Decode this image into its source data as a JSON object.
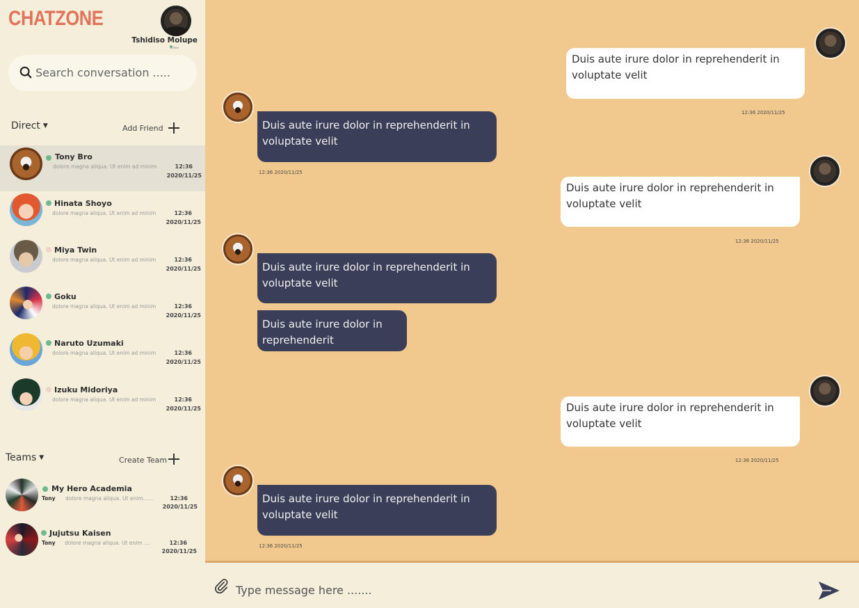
{
  "app": {
    "brand": "CHATZONE"
  },
  "user": {
    "name": "Tshidiso Molupe",
    "status": "online"
  },
  "search": {
    "placeholder": "Search conversation ....."
  },
  "direct": {
    "title": "Direct",
    "add_label": "Add Friend",
    "contacts": [
      {
        "name": "Tony Bro",
        "online": true,
        "preview": "dolore magna aliqua. Ut enim ad minim",
        "time": "12:36",
        "date": "2020/11/25"
      },
      {
        "name": "Hinata Shoyo",
        "online": true,
        "preview": "dolore magna aliqua. Ut enim ad minim",
        "time": "12:36",
        "date": "2020/11/25"
      },
      {
        "name": "Miya Twin",
        "online": false,
        "preview": "dolore magna aliqua. Ut enim ad minim",
        "time": "12:36",
        "date": "2020/11/25"
      },
      {
        "name": "Goku",
        "online": true,
        "preview": "dolore magna aliqua. Ut enim ad minim",
        "time": "12:36",
        "date": "2020/11/25"
      },
      {
        "name": "Naruto Uzumaki",
        "online": true,
        "preview": "dolore magna aliqua. Ut enim ad minim",
        "time": "12:36",
        "date": "2020/11/25"
      },
      {
        "name": "Izuku Midoriya",
        "online": false,
        "preview": "dolore magna aliqua. Ut enim ad minim",
        "time": "12:36",
        "date": "2020/11/25"
      }
    ]
  },
  "teams": {
    "title": "Teams",
    "add_label": "Create Team",
    "items": [
      {
        "name": "My Hero Academia",
        "online": true,
        "sender": "Tony",
        "preview": "dolore magna aliqua. Ut enim......",
        "time": "12:36",
        "date": "2020/11/25"
      },
      {
        "name": "Jujutsu Kaisen",
        "online": true,
        "sender": "Tony",
        "preview": "dolore magna aliqua. Ut enim ....",
        "time": "12:36",
        "date": "2020/11/25"
      }
    ]
  },
  "messages": [
    {
      "direction": "out",
      "text": "Duis aute irure dolor in reprehenderit in voluptate velit",
      "timestamp": "12:36  2020/11/25"
    },
    {
      "direction": "in",
      "text": "Duis aute irure dolor in reprehenderit in voluptate velit",
      "timestamp": "12:36  2020/11/25"
    },
    {
      "direction": "out",
      "text": "Duis aute irure dolor in reprehenderit in voluptate velit",
      "timestamp": "12:36  2020/11/25"
    },
    {
      "direction": "in",
      "text": "Duis aute irure dolor in reprehenderit in voluptate velit"
    },
    {
      "direction": "in",
      "text": "Duis aute irure dolor in reprehenderit"
    },
    {
      "direction": "out",
      "text": "Duis aute irure dolor in reprehenderit in voluptate velit",
      "timestamp": "12:36  2020/11/25"
    },
    {
      "direction": "in",
      "text": "Duis aute irure dolor in reprehenderit in voluptate velit",
      "timestamp": "12:36  2020/11/25"
    }
  ],
  "composer": {
    "placeholder": "Type message here ......."
  },
  "colors": {
    "brand": "#e0735a",
    "sidebar": "#f4eedb",
    "chat_bg": "#f1c88e",
    "incoming_bubble": "#3b3e58",
    "outgoing_bubble": "#ffffff",
    "online": "#6fb98f",
    "offline": "#efd3c4"
  }
}
